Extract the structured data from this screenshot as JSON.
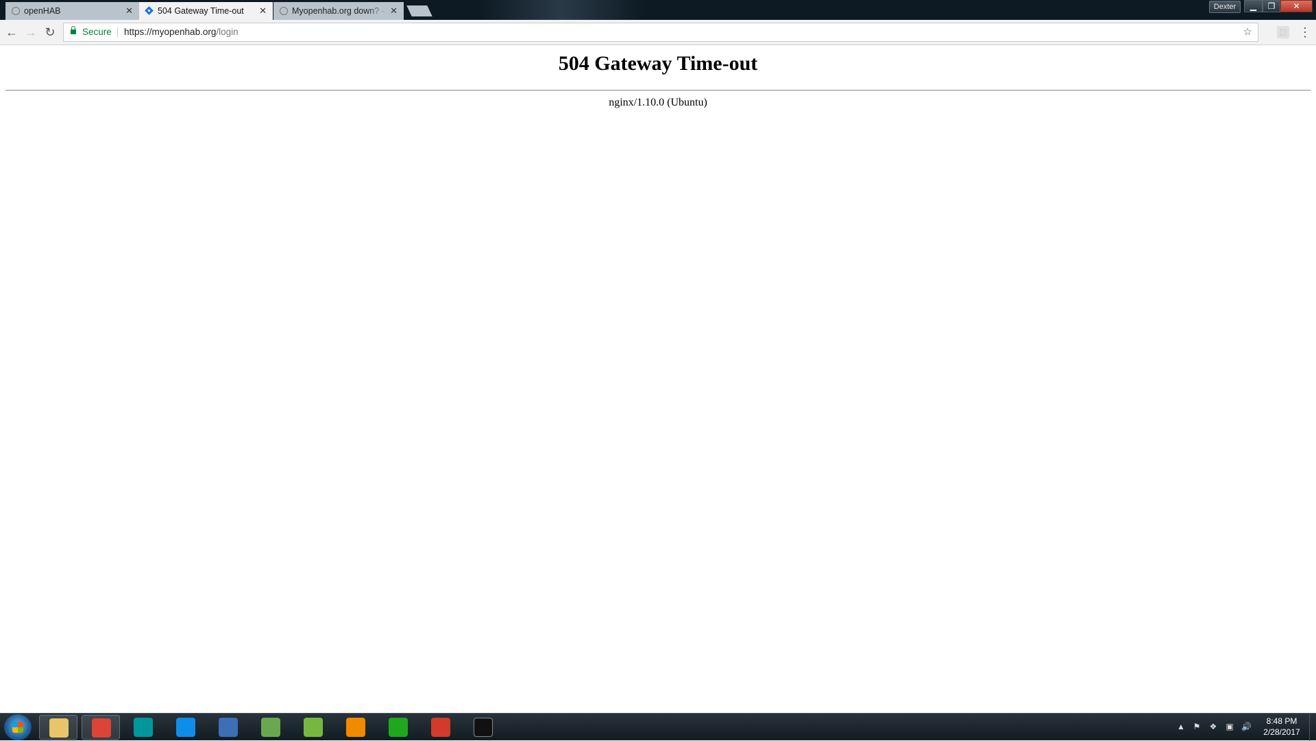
{
  "browser": {
    "tabs": [
      {
        "title": "openHAB",
        "state": "inactive",
        "favicon": "openhab-icon"
      },
      {
        "title": "504 Gateway Time-out",
        "state": "active",
        "favicon": "page-icon"
      },
      {
        "title": "Myopenhab.org down? -",
        "state": "inactive",
        "favicon": "openhab-icon"
      }
    ],
    "profile_name": "Dexter",
    "address": {
      "security_label": "Secure",
      "url_host": "https://myopenhab.org",
      "url_path": "/login"
    }
  },
  "page": {
    "title": "504 Gateway Time-out",
    "server_info": "nginx/1.10.0 (Ubuntu)"
  },
  "taskbar": {
    "clock_time": "8:48 PM",
    "clock_date": "2/28/2017",
    "apps": [
      {
        "name": "file-explorer-icon",
        "color": "#e8c46a"
      },
      {
        "name": "chrome-icon",
        "color": "#db4437"
      },
      {
        "name": "arduino-icon",
        "color": "#00979c"
      },
      {
        "name": "teamviewer-icon",
        "color": "#0e8ee9"
      },
      {
        "name": "network-tool-icon",
        "color": "#3b6fb6"
      },
      {
        "name": "spreadsheet-icon",
        "color": "#6aa84f"
      },
      {
        "name": "utorrent-icon",
        "color": "#76b83f"
      },
      {
        "name": "vlc-icon",
        "color": "#f08a00"
      },
      {
        "name": "green-app-icon",
        "color": "#1fa81f"
      },
      {
        "name": "pen-tool-icon",
        "color": "#d23b2a"
      },
      {
        "name": "command-prompt-icon",
        "color": "#111111"
      }
    ]
  }
}
